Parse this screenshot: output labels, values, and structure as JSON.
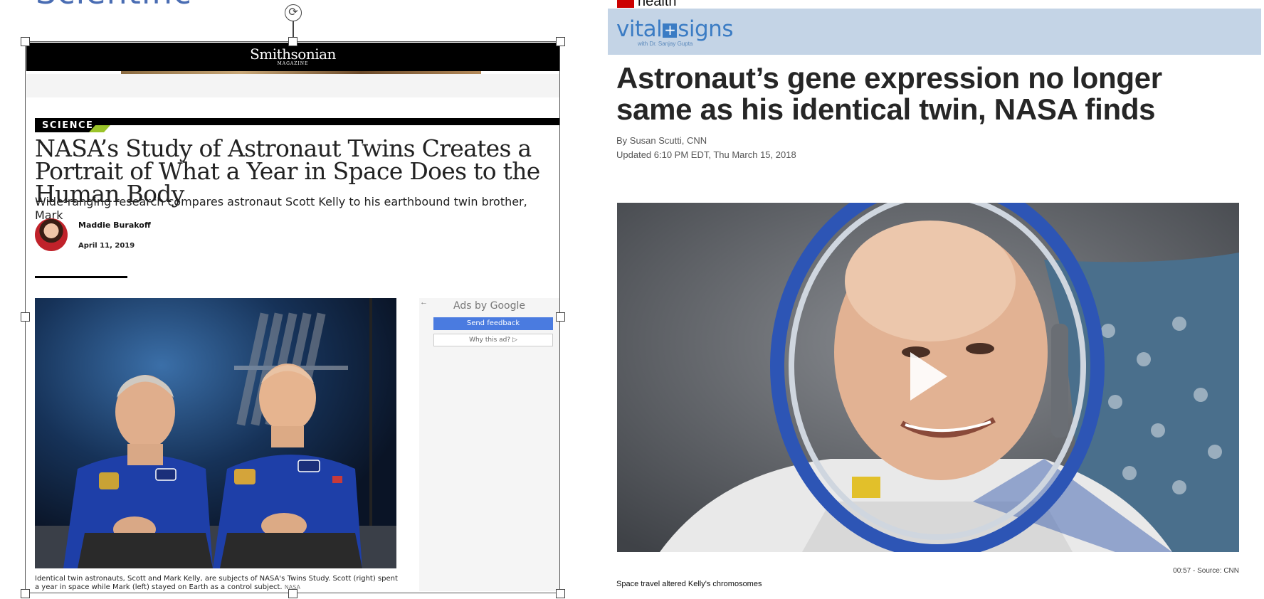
{
  "left": {
    "top_logo_fragment": "Scientific",
    "rotate_glyph": "⟳",
    "publication": {
      "logo": "Smithsonian",
      "sub": "MAGAZINE"
    },
    "section_tag": "SCIENCE",
    "headline": "NASA’s Study of Astronaut Twins Creates a Portrait of What a Year in Space Does to the Human Body",
    "dek": "Wide-ranging research compares astronaut Scott Kelly to his earthbound twin brother, Mark",
    "author": "Maddie Burakoff",
    "date": "April 11, 2019",
    "photo_caption": "Identical twin astronauts, Scott and Mark Kelly, are subjects of NASA's Twins Study. Scott (right) spent a year in space while Mark (left) stayed on Earth as a control subject.",
    "photo_credit": "NASA",
    "ad": {
      "back_arrow": "←",
      "ads_by": "Ads by Google",
      "send_feedback": "Send feedback",
      "why_this_ad": "Why this ad? ▷"
    }
  },
  "right": {
    "site_section": "health",
    "vital_logo_left": "vital",
    "vital_logo_plus": "+",
    "vital_logo_right": "signs",
    "vital_sub": "with Dr. Sanjay Gupta",
    "headline": "Astronaut’s gene expression no longer same as his identical twin, NASA finds",
    "byline": "By Susan Scutti, CNN",
    "updated": "Updated 6:10 PM EDT, Thu March 15, 2018",
    "video_meta": "00:57 - Source: CNN",
    "video_caption": "Space travel altered Kelly's chromosomes"
  },
  "colors": {
    "nasa_blue_suit": "#1e3fa8",
    "smithsonian_black": "#000000",
    "science_accent": "#9bc42a",
    "google_blue": "#4a7be0",
    "vital_bar": "#c4d4e6",
    "cnn_red": "#cc0000"
  }
}
